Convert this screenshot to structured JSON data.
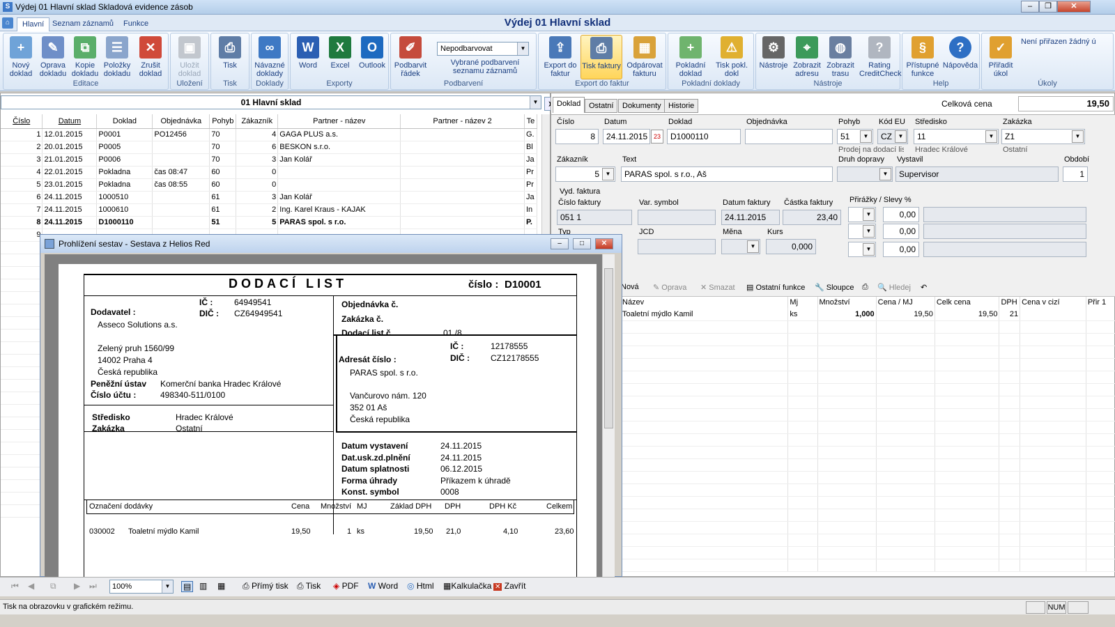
{
  "window": {
    "title": "Výdej 01 Hlavní sklad Skladová evidence zásob",
    "caption": "Výdej 01 Hlavní sklad"
  },
  "ribbon_tabs": [
    "Hlavní",
    "Seznam záznamů",
    "Funkce"
  ],
  "ribbon": {
    "editace": {
      "label": "Editace",
      "buttons": [
        "Nový doklad",
        "Oprava dokladu",
        "Kopie dokladu",
        "Položky dokladu",
        "Zrušit doklad"
      ]
    },
    "ulozeni": {
      "label": "Uložení",
      "buttons": [
        "Uložit doklad"
      ]
    },
    "tisk": {
      "label": "Tisk",
      "buttons": [
        "Tisk"
      ]
    },
    "doklady": {
      "label": "Doklady",
      "buttons": [
        "Návazné doklady"
      ]
    },
    "export": {
      "label": "Exporty",
      "buttons": [
        "Word",
        "Excel",
        "Outlook"
      ]
    },
    "podbarveni": {
      "label": "Podbarvení",
      "buttons": [
        "Podbarvit řádek"
      ],
      "combo": "Nepodbarvovat",
      "combo_caption": "Vybrané podbarvení seznamu záznamů"
    },
    "export_faktur": {
      "label": "Export do faktur",
      "buttons": [
        "Export do faktur",
        "Tisk faktury",
        "Odpárovat fakturu"
      ]
    },
    "pokladni": {
      "label": "Pokladní doklady",
      "buttons": [
        "Pokladní doklad",
        "Tisk pokl. dokl"
      ]
    },
    "nastroje": {
      "label": "Nástroje",
      "buttons": [
        "Nástroje",
        "Zobrazit adresu",
        "Zobrazit trasu",
        "Rating CreditCheck"
      ]
    },
    "help": {
      "label": "Help",
      "buttons": [
        "Přístupné funkce",
        "Nápověda"
      ]
    },
    "ukoly": {
      "label": "Úkoly",
      "buttons": [
        "Přiřadit úkol"
      ],
      "note": "Není přiřazen žádný ú"
    }
  },
  "left": {
    "selector": "01  Hlavní sklad",
    "columns": [
      "Číslo",
      "Datum",
      "Doklad",
      "Objednávka",
      "Pohyb",
      "Zákazník",
      "Partner - název",
      "Partner - název 2",
      "Te"
    ],
    "rows": [
      [
        "1",
        "12.01.2015",
        "P0001",
        "PO12456",
        "70",
        "4",
        "GAGA PLUS a.s.",
        "",
        "G."
      ],
      [
        "2",
        "20.01.2015",
        "P0005",
        "",
        "70",
        "6",
        "BESKON s.r.o.",
        "",
        "Bl"
      ],
      [
        "3",
        "21.01.2015",
        "P0006",
        "",
        "70",
        "3",
        "Jan Kolář",
        "",
        "Ja"
      ],
      [
        "4",
        "22.01.2015",
        "Pokladna",
        "čas 08:47",
        "60",
        "0",
        "",
        "",
        "Pr"
      ],
      [
        "5",
        "23.01.2015",
        "Pokladna",
        "čas 08:55",
        "60",
        "0",
        "",
        "",
        "Pr"
      ],
      [
        "6",
        "24.11.2015",
        "1000510",
        "",
        "61",
        "3",
        "Jan Kolář",
        "",
        "Ja"
      ],
      [
        "7",
        "24.11.2015",
        "1000610",
        "",
        "61",
        "2",
        "Ing. Karel Kraus - KAJAK",
        "",
        "In"
      ],
      [
        "8",
        "24.11.2015",
        "D1000110",
        "",
        "51",
        "5",
        "PARAS spol. s r.o.",
        "",
        "P."
      ],
      [
        "9",
        "",
        "",
        "",
        "",
        "",
        "",
        "",
        ""
      ]
    ]
  },
  "right": {
    "tabs": [
      "Doklad",
      "Ostatní",
      "Dokumenty",
      "Historie"
    ],
    "celkova_cena_label": "Celková cena",
    "celkova_cena": "19,50",
    "labels": {
      "cislo": "Číslo",
      "datum": "Datum",
      "doklad": "Doklad",
      "objednavka": "Objednávka",
      "pohyb": "Pohyb",
      "kod_eu": "Kód EU",
      "stredisko": "Středisko",
      "zakazka": "Zakázka",
      "zakaznik": "Zákazník",
      "text": "Text",
      "druh_dopravy": "Druh dopravy",
      "vystavil": "Vystavil",
      "obdobi": "Období",
      "vyd_faktura": "Vyd. faktura",
      "cislo_faktury": "Číslo faktury",
      "var_symbol": "Var. symbol",
      "datum_faktury": "Datum faktury",
      "castka_faktury": "Částka faktury",
      "prirazky": "Přirážky / Slevy %",
      "typ": "Typ",
      "jcd": "JCD",
      "mena": "Měna",
      "kurs": "Kurs"
    },
    "values": {
      "cislo": "8",
      "datum": "24.11.2015",
      "doklad": "D1000110",
      "objednavka": "",
      "pohyb": "51",
      "pohyb_sub": "Prodej na dodací list - p",
      "kod_eu": "CZ",
      "stredisko": "11",
      "stredisko_sub": "Hradec Králové",
      "zakazka": "Z1",
      "zakazka_sub": "Ostatní",
      "zakaznik": "5",
      "text": "PARAS spol. s r.o., Aš",
      "druh_dopravy": "",
      "vystavil": "Supervisor",
      "obdobi": "1",
      "cislo_faktury": "051   1",
      "var_symbol": "",
      "datum_faktury": "24.11.2015",
      "castka_faktury": "23,40",
      "prirazky": [
        "0,00",
        "0,00",
        "0,00"
      ],
      "kurs": "0,000"
    },
    "item_toolbar": [
      "Nová",
      "Oprava",
      "Smazat",
      "Ostatní funkce",
      "Sloupce",
      "Hledej"
    ],
    "item_columns": [
      "Název",
      "Mj",
      "Množství",
      "Cena / MJ",
      "Celk cena",
      "DPH",
      "Cena v cizí",
      "Přir 1"
    ],
    "items": [
      [
        "Toaletní mýdlo Kamil",
        "ks",
        "1,000",
        "19,50",
        "19,50",
        "21",
        "",
        ""
      ]
    ]
  },
  "report": {
    "title": "Prohlížení sestav - Sestava z Helios Red",
    "heading": "DODACÍ LIST",
    "cislo_label": "číslo :",
    "cislo": "D10001",
    "dodavatel_label": "Dodavatel :",
    "ic_label": "IČ :",
    "dic_label": "DIČ :",
    "dodavatel_ic": "64949541",
    "dodavatel_dic": "CZ64949541",
    "dodavatel_name": "Asseco Solutions a.s.",
    "dodavatel_street": "Zelený pruh 1560/99",
    "dodavatel_city": "14002  Praha 4",
    "dodavatel_country": "Česká republika",
    "penezni_ustav_label": "Peněžní ústav",
    "penezni_ustav": "Komerční banka Hradec Králové",
    "cislo_uctu_label": "Číslo účtu :",
    "cislo_uctu": "498340-511/0100",
    "objednavka_label": "Objednávka  č.",
    "zakazka_label": "Zakázka     č.",
    "dodaci_list_label": "Dodací list č.",
    "dodaci_list": "01 /8",
    "adresat_label": "Adresát číslo :",
    "adresat_ic": "12178555",
    "adresat_dic": "CZ12178555",
    "adresat_name": "PARAS spol. s r.o.",
    "adresat_street": "Vančurovo nám. 120",
    "adresat_city": "352 01  Aš",
    "adresat_country": "Česká republika",
    "stredisko_label": "Středisko",
    "stredisko": "Hradec Králové",
    "zakazka2_label": "Zakázka",
    "zakazka2": "Ostatní",
    "datum_vystaveni_label": "Datum vystavení",
    "datum_vystaveni": "24.11.2015",
    "dat_usk_label": "Dat.usk.zd.plnění",
    "dat_usk": "24.11.2015",
    "datum_splatnosti_label": "Datum splatnosti",
    "datum_splatnosti": "06.12.2015",
    "forma_uhrady_label": "Forma úhrady",
    "forma_uhrady": "Příkazem k úhradě",
    "konst_symbol_label": "Konst. symbol",
    "konst_symbol": "0008",
    "item_headers": [
      "Označení dodávky",
      "Cena",
      "Množství",
      "MJ",
      "Základ DPH",
      "DPH",
      "DPH Kč",
      "Celkem"
    ],
    "item": [
      "030002",
      "Toaletní mýdlo Kamil",
      "19,50",
      "1",
      "ks",
      "19,50",
      "21,0",
      "4,10",
      "23,60"
    ]
  },
  "bottombar": {
    "zoom": "100%",
    "buttons": [
      "Přímý tisk",
      "Tisk",
      "PDF",
      "Word",
      "Html",
      "Kalkulačka",
      "Zavřít"
    ]
  },
  "status": {
    "text": "Tisk na obrazovku v grafickém režimu.",
    "num": "NUM"
  }
}
